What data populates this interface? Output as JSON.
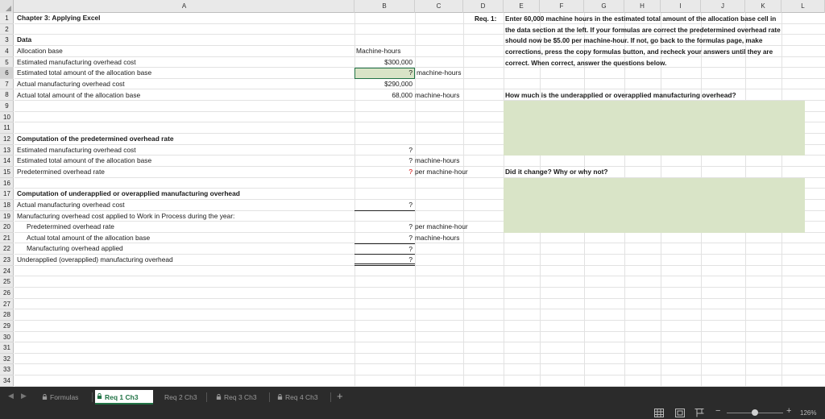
{
  "columns": [
    "A",
    "B",
    "C",
    "D",
    "E",
    "F",
    "G",
    "H",
    "I",
    "J",
    "K",
    "L"
  ],
  "rows": [
    "1",
    "2",
    "3",
    "4",
    "5",
    "6",
    "7",
    "8",
    "9",
    "10",
    "11",
    "12",
    "13",
    "14",
    "15",
    "16",
    "17",
    "18",
    "19",
    "20",
    "21",
    "22",
    "23",
    "24",
    "25",
    "26",
    "27",
    "28",
    "29",
    "30",
    "31",
    "32",
    "33",
    "34"
  ],
  "cells": {
    "a1": "Chapter 3: Applying Excel",
    "a3": "Data",
    "a4": "Allocation base",
    "a5": "Estimated manufacturing overhead cost",
    "a6": "Estimated total amount of the allocation base",
    "a7": "Actual manufacturing overhead cost",
    "a8": "Actual total amount of the allocation base",
    "a12": "Computation of the predetermined overhead rate",
    "a13": "Estimated manufacturing overhead cost",
    "a14": "Estimated total amount of the allocation base",
    "a15": "Predetermined overhead rate",
    "a17": "Computation of underapplied or overapplied manufacturing overhead",
    "a18": "Actual manufacturing overhead cost",
    "a19": "Manufacturing overhead cost applied to Work in Process during the year:",
    "a20": "Predetermined overhead rate",
    "a21": "Actual total amount of the allocation base",
    "a22": "Manufacturing overhead applied",
    "a23": "Underapplied (overapplied) manufacturing overhead",
    "b4": "Machine-hours",
    "b5": "$300,000",
    "b6": "?",
    "c6": "machine-hours",
    "b7": "$290,000",
    "b8": "68,000",
    "c8": "machine-hours",
    "b13": "?",
    "b14": "?",
    "c14": "machine-hours",
    "b15": "?",
    "c15": "per machine-hour",
    "b18": "?",
    "b20": "?",
    "c20": "per machine-hour",
    "b21": "?",
    "c21": "machine-hours",
    "b22": "?",
    "b23": "?",
    "d1": "Req. 1:",
    "note": "Enter 60,000 machine hours in the estimated total amount of the allocation base cell in the data section at the left.  If your formulas are correct the predetermined overhead rate should now be $5.00 per machine-hour.  If not, go back to the formulas page, make corrections, press the copy formulas button, and recheck your answers until they are correct.  When correct, answer the questions below.",
    "q1": "How much is the underapplied or overapplied manufacturing overhead?",
    "q2": "Did it change?  Why or why not?"
  },
  "tabs": [
    "Formulas",
    "Req 1 Ch3",
    "Req 2 Ch3",
    "Req 3 Ch3",
    "Req 4 Ch3"
  ],
  "active_tab": "Req 1 Ch3",
  "zoom": "126%",
  "colors": {
    "selection": "#217346",
    "answer_fill": "#d9e4c7",
    "red_mark": "#d40000"
  }
}
